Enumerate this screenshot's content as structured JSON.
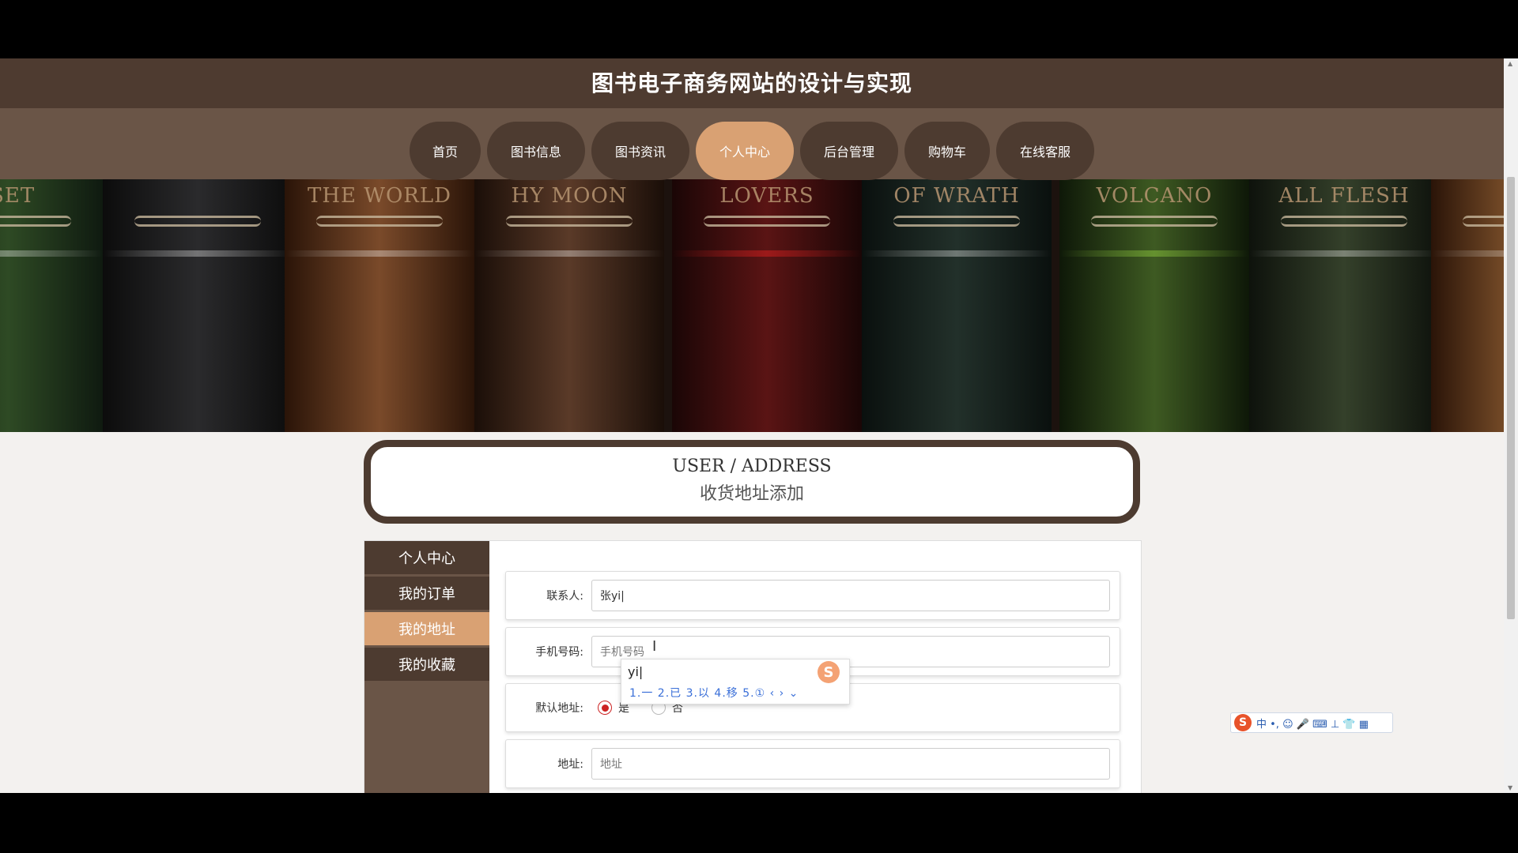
{
  "site": {
    "title": "图书电子商务网站的设计与实现"
  },
  "nav": {
    "items": [
      {
        "label": "首页"
      },
      {
        "label": "图书信息"
      },
      {
        "label": "图书资讯"
      },
      {
        "label": "个人中心",
        "active": true
      },
      {
        "label": "后台管理"
      },
      {
        "label": "购物车"
      },
      {
        "label": "在线客服"
      }
    ]
  },
  "banner": {
    "spines": [
      "ISET",
      "THE WORLD",
      "HY MOON",
      "LOVERS",
      "OF WRATH",
      "VOLCANO",
      "ALL FLESH"
    ],
    "active_slide": 1,
    "slide_count": 3
  },
  "page_header": {
    "title_en": "USER / ADDRESS",
    "title_cn": "收货地址添加"
  },
  "sidebar": {
    "items": [
      {
        "label": "个人中心"
      },
      {
        "label": "我的订单"
      },
      {
        "label": "我的地址",
        "active": true
      },
      {
        "label": "我的收藏"
      }
    ]
  },
  "form": {
    "contact_label": "联系人:",
    "contact_value": "张yi|",
    "phone_label": "手机号码:",
    "phone_placeholder": "手机号码",
    "default_label": "默认地址:",
    "default_yes": "是",
    "default_no": "否",
    "default_selected": "是",
    "address_label": "地址:",
    "address_placeholder": "地址"
  },
  "ime": {
    "composition": "yi|",
    "candidates": "1.一  2.已  3.以  4.移  5.①  ‹ › ⌄",
    "logo": "S"
  },
  "tray": {
    "logo": "S",
    "items": "中 •, ☺ 🎤 ⌨ ⊥ 👕 ▦"
  },
  "colors": {
    "brown_dark": "#4d3b30",
    "brown_mid": "#6a5547",
    "accent": "#d9a173"
  }
}
